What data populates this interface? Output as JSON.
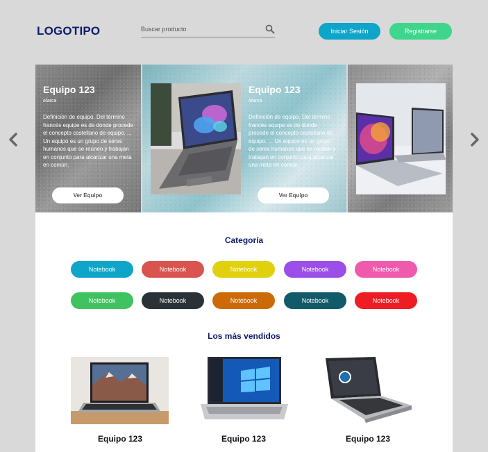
{
  "header": {
    "logo": "LOGOTIPO",
    "search_placeholder": "Buscar producto",
    "login_label": "Iniciar Sesión",
    "register_label": "Registrarse"
  },
  "carousel": {
    "cards": [
      {
        "title": "Equipo 123",
        "brand": "Marca",
        "description": "Definición de equipo. Del término francés equipe es de donde procede el concepto castellano de equipo. ... Un equipo es un grupo de seres humanos que se reúnen y trabajan en conjunto para alcanzar una meta en común.",
        "button": "Ver Equipo"
      },
      {
        "title": "Equipo 123",
        "brand": "Marca",
        "description": "Definición de equipo. Del término francés equipe es de donde procede el concepto castellano de equipo. ... Un equipo es un grupo de seres humanos que se reúnen y trabajan en conjunto para alcanzar una meta en común.",
        "button": "Ver Equipo"
      }
    ]
  },
  "categories": {
    "title": "Categoría",
    "items": [
      {
        "label": "Notebook",
        "color": "#0ea5c9"
      },
      {
        "label": "Notebook",
        "color": "#d9534f"
      },
      {
        "label": "Notebook",
        "color": "#e0d00e"
      },
      {
        "label": "Notebook",
        "color": "#9b4fe8"
      },
      {
        "label": "Notebook",
        "color": "#f05aac"
      },
      {
        "label": "Notebook",
        "color": "#3fc25f"
      },
      {
        "label": "Notebook",
        "color": "#2a3238"
      },
      {
        "label": "Notebook",
        "color": "#cc6a08"
      },
      {
        "label": "Notebook",
        "color": "#125a6a"
      },
      {
        "label": "Notebook",
        "color": "#ee1c24"
      }
    ]
  },
  "best_sellers": {
    "title": "Los más vendidos",
    "products": [
      {
        "name": "Equipo 123"
      },
      {
        "name": "Equipo 123"
      },
      {
        "name": "Equipo 123"
      }
    ]
  }
}
